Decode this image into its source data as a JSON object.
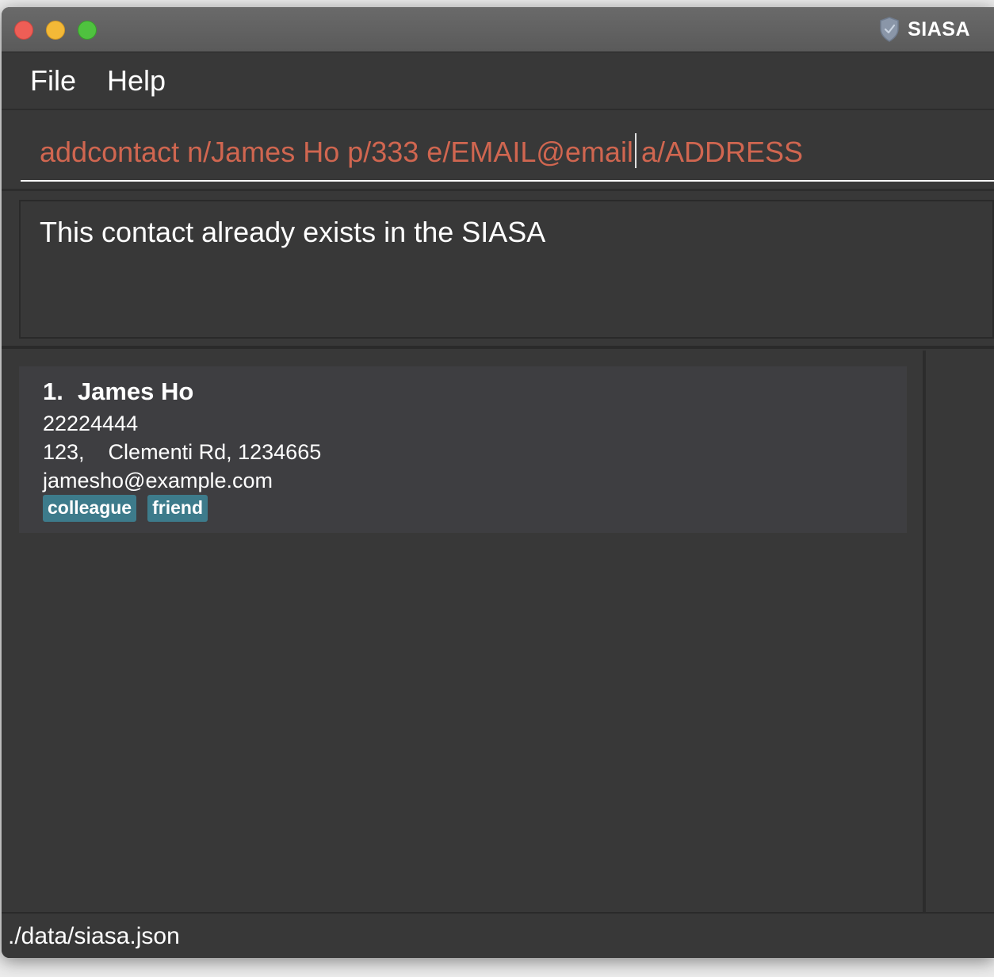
{
  "window": {
    "title": "SIASA"
  },
  "menu": {
    "file": "File",
    "help": "Help"
  },
  "command_box": {
    "value_before_cursor": "addcontact n/James Ho p/333 e/EMAIL@email",
    "value_after_cursor": "a/ADDRESS",
    "text_color": "#d06650"
  },
  "result": {
    "message": "This contact already exists in the SIASA"
  },
  "contacts": [
    {
      "index": "1.",
      "name": "James Ho",
      "phone": "22224444",
      "address": "123,    Clementi Rd, 1234665",
      "email": "jamesho@example.com",
      "tags": [
        "colleague",
        "friend"
      ]
    }
  ],
  "status_bar": {
    "path": "./data/siasa.json"
  },
  "colors": {
    "background": "#383838",
    "card": "#3e3e41",
    "tag": "#3d7b8b",
    "error_text": "#d06650"
  },
  "icons": {
    "app_icon": "shield-icon"
  }
}
